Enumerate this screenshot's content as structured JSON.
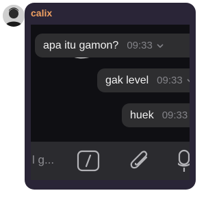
{
  "chat": {
    "sender": "calix",
    "messages": [
      {
        "text": "apa itu gamon?",
        "time": "09:33"
      },
      {
        "text": "gak level",
        "time": "09:33"
      },
      {
        "text": "huek",
        "time": "09:33"
      }
    ]
  },
  "composer": {
    "placeholder": "l g..."
  },
  "icons": {
    "avatar": "profile-avatar",
    "compose": [
      "gif-icon",
      "attachment-icon",
      "microphone-icon"
    ],
    "bubble_menu": "chevron-down-icon"
  },
  "colors": {
    "card_background": "#2a2537",
    "sender_name": "#f0a062",
    "bubble_background": "#2e2e30",
    "bubble_text": "#f2f2f2",
    "timestamp": "#838388"
  }
}
